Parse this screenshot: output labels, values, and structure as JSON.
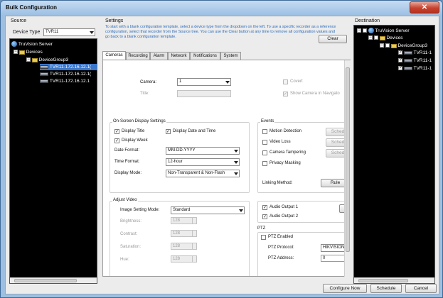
{
  "window": {
    "title": "Bulk Configuration",
    "close_glyph": "✕"
  },
  "source": {
    "label": "Source",
    "device_type_label": "Device Type",
    "device_type_value": "TVR11",
    "tree": {
      "server": "TruVision Server",
      "devices": "Devices",
      "group": "DeviceGroup3",
      "recorders": [
        "TVR11-172.16.12.1(",
        "TVR11-172.16.12.1(",
        "TVR11-172.16.12.1"
      ]
    }
  },
  "settings": {
    "label": "Settings",
    "description": "To start with a blank configuration template, select a device type from the dropdown on the left. To use a specific recorder as a reference configuration, select that recorder from the Source tree. You can use the Clear button at any time to remove all configuration values and go back to a blank configuration template.",
    "clear_button": "Clear",
    "tabs": [
      "Cameras",
      "Recording",
      "Alarm",
      "Network",
      "Notifications",
      "System"
    ],
    "active_tab": "Cameras",
    "camera_label": "Camera:",
    "camera_value": "1",
    "title_label": "Title:",
    "covert_label": "Covert",
    "show_camera_label": "Show Camera in Navigato",
    "osd": {
      "title": "On-Screen Display Settings",
      "display_title": "Display Title",
      "display_date_time": "Display Date and Time",
      "display_week": "Display Week",
      "date_format_label": "Date Format:",
      "date_format_value": "MM-DD-YYYY",
      "time_format_label": "Time Format:",
      "time_format_value": "12-hour",
      "display_mode_label": "Display Mode:",
      "display_mode_value": "Non-Transparent & Non-Flash",
      "check": "✓"
    },
    "events": {
      "title": "Events",
      "motion_detection": "Motion Detection",
      "video_loss": "Video Loss",
      "camera_tampering": "Camera Tampering",
      "privacy_masking": "Privacy Masking",
      "schedule_btn": "Sched",
      "linking_method_label": "Linking Method:",
      "rules_btn": "Rule"
    },
    "adjust_video": {
      "title": "Adjust Video",
      "image_mode_label": "Image Setting Mode:",
      "image_mode_value": "Standard",
      "brightness_label": "Brightness:",
      "brightness_value": "128",
      "contrast_label": "Contrast:",
      "contrast_value": "128",
      "saturation_label": "Saturation:",
      "saturation_value": "128",
      "hue_label": "Hue:",
      "hue_value": "128"
    },
    "audio": {
      "output1": "Audio Output 1",
      "output2": "Audio Output 2"
    },
    "ptz": {
      "title": "PTZ",
      "enabled_label": "PTZ Enabled",
      "protocol_label": "PTZ Protocol:",
      "protocol_value": "HIKVISION",
      "address_label": "PTZ Address:",
      "address_value": "0"
    }
  },
  "destination": {
    "label": "Destination",
    "tree": {
      "server": "TruVision Server",
      "devices": "Devices",
      "group": "DeviceGroup3",
      "recorders": [
        "TVR11-1",
        "TVR11-1",
        "TVR11-1"
      ]
    }
  },
  "footer": {
    "configure_now": "Configure Now",
    "schedule": "Schedule",
    "cancel": "Cancel"
  }
}
